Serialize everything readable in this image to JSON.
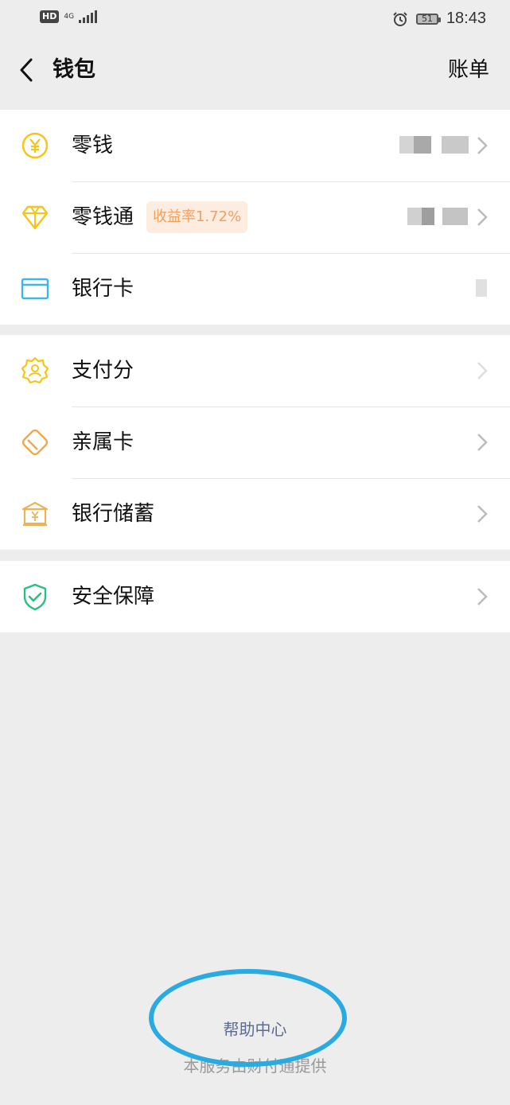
{
  "status": {
    "hd": "HD",
    "network": "4G",
    "battery": "51",
    "time": "18:43",
    "icons": [
      "signal-icon",
      "alarm-icon",
      "battery-icon"
    ]
  },
  "nav": {
    "back_icon": "chevron-left-icon",
    "title": "钱包",
    "bill": "账单"
  },
  "groups": [
    {
      "items": [
        {
          "label": "零钱",
          "icon": "yuan-coin-icon",
          "icon_color": "#f5c518",
          "value_masked": true
        },
        {
          "label": "零钱通",
          "icon": "diamond-icon",
          "icon_color": "#f5c518",
          "badge": "收益率1.72%",
          "value_masked": true
        },
        {
          "label": "银行卡",
          "icon": "card-icon",
          "icon_color": "#3fb6e8",
          "value_masked": true
        }
      ]
    },
    {
      "items": [
        {
          "label": "支付分",
          "icon": "score-badge-icon",
          "icon_color": "#f5c518"
        },
        {
          "label": "亲属卡",
          "icon": "family-card-icon",
          "icon_color": "#f0a84a"
        },
        {
          "label": "银行储蓄",
          "icon": "bank-icon",
          "icon_color": "#e8b55a"
        }
      ]
    },
    {
      "items": [
        {
          "label": "安全保障",
          "icon": "shield-check-icon",
          "icon_color": "#2bbf82"
        }
      ]
    }
  ],
  "footer": {
    "help": "帮助中心",
    "provider": "本服务由财付通提供"
  },
  "colors": {
    "background": "#ededed",
    "highlight": "#29abe2",
    "link": "#5b6c92"
  }
}
